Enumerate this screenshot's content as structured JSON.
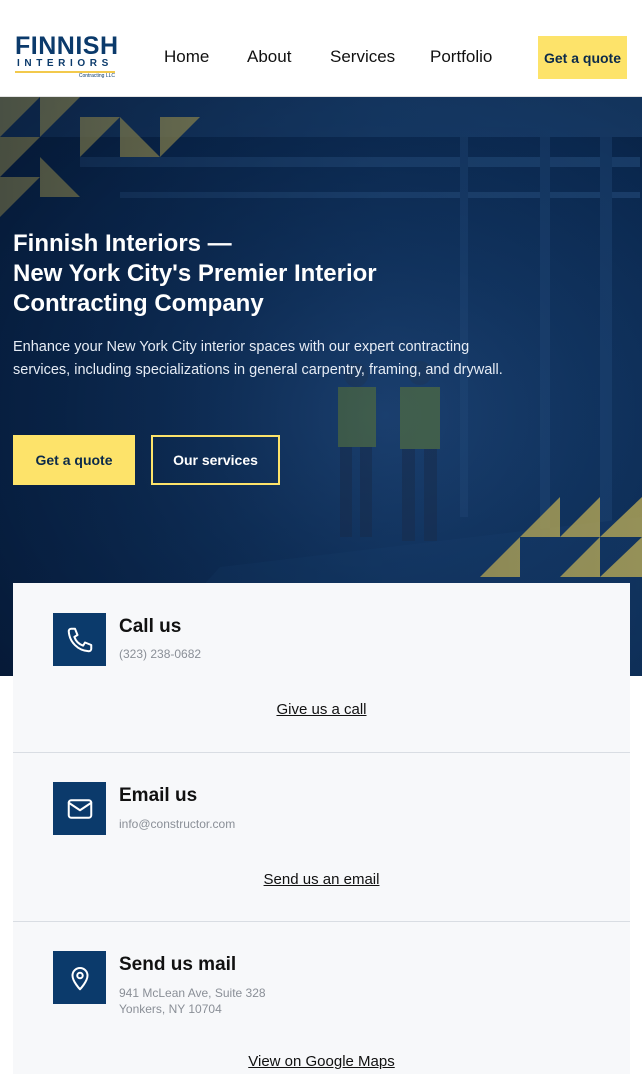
{
  "logo": {
    "main": "FINNISH",
    "sub": "INTERIORS",
    "tiny": "Contracting LLC"
  },
  "nav": {
    "items": [
      {
        "label": "Home"
      },
      {
        "label": "About"
      },
      {
        "label": "Services"
      },
      {
        "label": "Portfolio"
      }
    ],
    "cta_label": "Get a quote"
  },
  "hero": {
    "title_line1": "Finnish Interiors —",
    "title_line2": "New York City's Premier Interior",
    "title_line3": "Contracting Company",
    "description": "Enhance your New York City interior spaces with our expert contracting services, including specializations in general carpentry, framing, and drywall.",
    "primary_button": "Get a quote",
    "secondary_button": "Our services"
  },
  "contact": {
    "call": {
      "title": "Call us",
      "detail": "(323) 238-0682",
      "link": "Give us a call",
      "icon": "phone-icon"
    },
    "email": {
      "title": "Email us",
      "detail": "info@constructor.com",
      "link": "Send us an email",
      "icon": "envelope-icon"
    },
    "mail": {
      "title": "Send us mail",
      "address_line1": "941 McLean Ave, Suite 328",
      "address_line2": "Yonkers, NY 10704",
      "link": "View on Google Maps",
      "icon": "map-pin-icon"
    }
  },
  "colors": {
    "brand_navy": "#0b3a6b",
    "accent_yellow": "#fde36a",
    "panel_bg": "#f7f8fa"
  }
}
